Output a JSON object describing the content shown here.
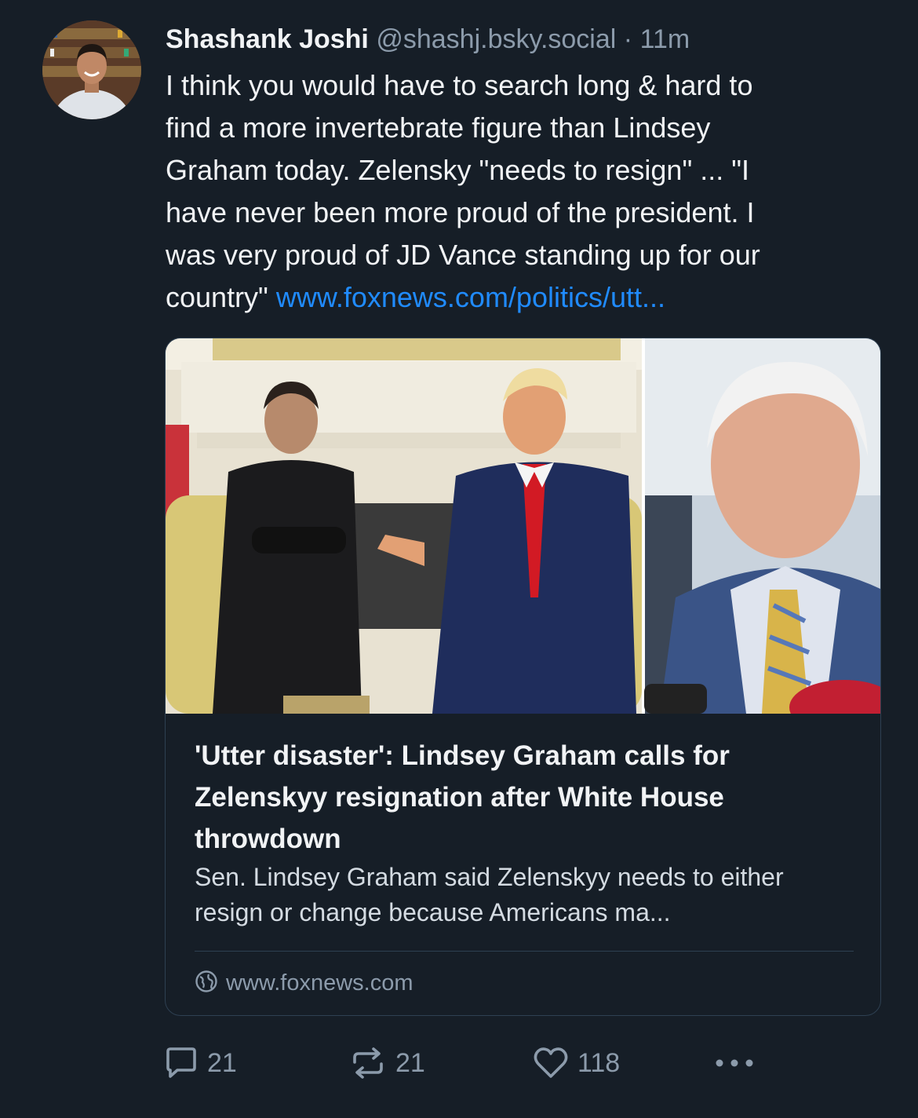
{
  "post": {
    "author_name": "Shashank Joshi",
    "handle": "@shashj.bsky.social",
    "separator": "·",
    "timestamp": "11m",
    "text_line_1": "I think you would have to search long & hard to",
    "text_line_2": "find a more invertebrate figure than Lindsey",
    "text_line_3": "Graham today. Zelensky \"needs to resign\" ... \"I",
    "text_line_4": "have never been more proud of the president. I",
    "text_line_5": "was very proud of JD Vance standing up for our",
    "text_line_6": "country\" ",
    "text_link": "www.foxnews.com/politics/utt..."
  },
  "link_card": {
    "title": "'Utter disaster': Lindsey Graham calls for Zelenskyy resignation after White House throwdown",
    "description": "Sen. Lindsey Graham said Zelenskyy needs to either resign or change because Americans ma...",
    "domain": "www.foxnews.com",
    "domain_icon": "globe-icon"
  },
  "actions": {
    "reply_count": "21",
    "repost_count": "21",
    "like_count": "118",
    "reply_icon": "comment-icon",
    "repost_icon": "repost-icon",
    "like_icon": "heart-icon",
    "more_icon": "more-dots-icon"
  },
  "colors": {
    "background": "#161e27",
    "link": "#208bfe",
    "muted": "#8c9bab",
    "border": "#2e4052"
  }
}
